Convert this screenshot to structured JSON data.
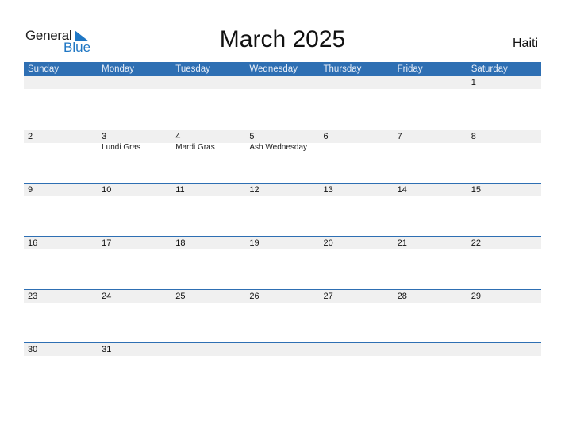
{
  "logo": {
    "word1": "General",
    "word2": "Blue"
  },
  "title": "March 2025",
  "country": "Haiti",
  "colors": {
    "header_bg": "#2e6fb3",
    "band": "#f0f0f0",
    "brand": "#1f77c4"
  },
  "weekdays": [
    "Sunday",
    "Monday",
    "Tuesday",
    "Wednesday",
    "Thursday",
    "Friday",
    "Saturday"
  ],
  "weeks": [
    [
      {
        "day": "",
        "event": ""
      },
      {
        "day": "",
        "event": ""
      },
      {
        "day": "",
        "event": ""
      },
      {
        "day": "",
        "event": ""
      },
      {
        "day": "",
        "event": ""
      },
      {
        "day": "",
        "event": ""
      },
      {
        "day": "1",
        "event": ""
      }
    ],
    [
      {
        "day": "2",
        "event": ""
      },
      {
        "day": "3",
        "event": "Lundi Gras"
      },
      {
        "day": "4",
        "event": "Mardi Gras"
      },
      {
        "day": "5",
        "event": "Ash Wednesday"
      },
      {
        "day": "6",
        "event": ""
      },
      {
        "day": "7",
        "event": ""
      },
      {
        "day": "8",
        "event": ""
      }
    ],
    [
      {
        "day": "9",
        "event": ""
      },
      {
        "day": "10",
        "event": ""
      },
      {
        "day": "11",
        "event": ""
      },
      {
        "day": "12",
        "event": ""
      },
      {
        "day": "13",
        "event": ""
      },
      {
        "day": "14",
        "event": ""
      },
      {
        "day": "15",
        "event": ""
      }
    ],
    [
      {
        "day": "16",
        "event": ""
      },
      {
        "day": "17",
        "event": ""
      },
      {
        "day": "18",
        "event": ""
      },
      {
        "day": "19",
        "event": ""
      },
      {
        "day": "20",
        "event": ""
      },
      {
        "day": "21",
        "event": ""
      },
      {
        "day": "22",
        "event": ""
      }
    ],
    [
      {
        "day": "23",
        "event": ""
      },
      {
        "day": "24",
        "event": ""
      },
      {
        "day": "25",
        "event": ""
      },
      {
        "day": "26",
        "event": ""
      },
      {
        "day": "27",
        "event": ""
      },
      {
        "day": "28",
        "event": ""
      },
      {
        "day": "29",
        "event": ""
      }
    ],
    [
      {
        "day": "30",
        "event": ""
      },
      {
        "day": "31",
        "event": ""
      },
      {
        "day": "",
        "event": ""
      },
      {
        "day": "",
        "event": ""
      },
      {
        "day": "",
        "event": ""
      },
      {
        "day": "",
        "event": ""
      },
      {
        "day": "",
        "event": ""
      }
    ]
  ]
}
